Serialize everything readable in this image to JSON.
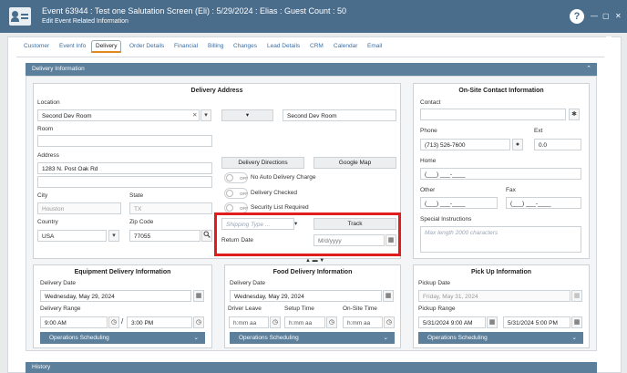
{
  "header": {
    "title": "Event 63944 : Test one Salutation Screen (Eli) : 5/29/2024 : Elias : Guest Count : 50",
    "subtitle": "Edit Event Related Information",
    "help": "?",
    "minimize": "—",
    "maximize": "▢",
    "close": "✕"
  },
  "tabs": [
    "Customer",
    "Event Info",
    "Delivery",
    "Order Details",
    "Financial",
    "Billing",
    "Changes",
    "Lead Details",
    "CRM",
    "Calendar",
    "Email"
  ],
  "section": {
    "title": "Delivery Information"
  },
  "delivery_address": {
    "title": "Delivery Address",
    "location_label": "Location",
    "location_value": "Second Dev Room",
    "location_right": "Second Dev Room",
    "clear": "✕",
    "dd": "▾",
    "mid_dd": "▾",
    "room_label": "Room",
    "room_value": "",
    "address_label": "Address",
    "address_value": "1283 N. Post Oak Rd",
    "address2_value": "",
    "city_label": "City",
    "city_value": "Houston",
    "state_label": "State",
    "state_value": "TX",
    "country_label": "Country",
    "country_value": "USA",
    "zip_label": "Zip Code",
    "zip_value": "77055",
    "directions": "Delivery Directions",
    "map": "Google Map",
    "toggles": [
      {
        "state": "OFF",
        "label": "No Auto Delivery Charge"
      },
      {
        "state": "OFF",
        "label": "Delivery Checked"
      },
      {
        "state": "OFF",
        "label": "Security List Required"
      }
    ],
    "shipping_placeholder": "Shipping Type ...",
    "track": "Track",
    "return_label": "Return Date",
    "return_placeholder": "M/d/yyyy"
  },
  "contact": {
    "title": "On-Site Contact Information",
    "contact_label": "Contact",
    "contact_value": "",
    "phone_label": "Phone",
    "phone_value": "(713) 526-7600",
    "ext_label": "Ext",
    "ext_value": "0.0",
    "home_label": "Home",
    "home_value": "(___) ___-____",
    "other_label": "Other",
    "other_value": "(___) ___-____",
    "fax_label": "Fax",
    "fax_value": "(___) ___-____",
    "instructions_label": "Special Instructions",
    "instructions_placeholder": "Max length 2000 characters"
  },
  "equipment": {
    "title": "Equipment Delivery Information",
    "date_label": "Delivery Date",
    "date_value": "Wednesday, May 29, 2024",
    "range_label": "Delivery Range",
    "from": "9:00 AM",
    "sep": "/",
    "to": "3:00 PM",
    "ops": "Operations Scheduling"
  },
  "food": {
    "title": "Food Delivery Information",
    "date_label": "Delivery Date",
    "date_value": "Wednesday, May 29, 2024",
    "leave_label": "Driver Leave",
    "setup_label": "Setup Time",
    "onsite_label": "On-Site Time",
    "time_placeholder": "h:mm aa",
    "ops": "Operations Scheduling"
  },
  "pickup": {
    "title": "Pick Up Information",
    "date_label": "Pickup Date",
    "date_value": "Friday, May 31, 2024",
    "range_label": "Pickup Range",
    "from": "5/31/2024 9:00 AM",
    "to": "5/31/2024 5:00 PM",
    "ops": "Operations Scheduling"
  },
  "history": {
    "title": "History"
  },
  "icons": {
    "calendar": "calendar-icon",
    "clock": "clock-icon",
    "chevron": "⌄"
  },
  "colors": {
    "titlebar": "#4a6d8c",
    "section": "#5c7f9c",
    "highlight": "#e01e1e",
    "active_tab": "#e08a1e"
  }
}
